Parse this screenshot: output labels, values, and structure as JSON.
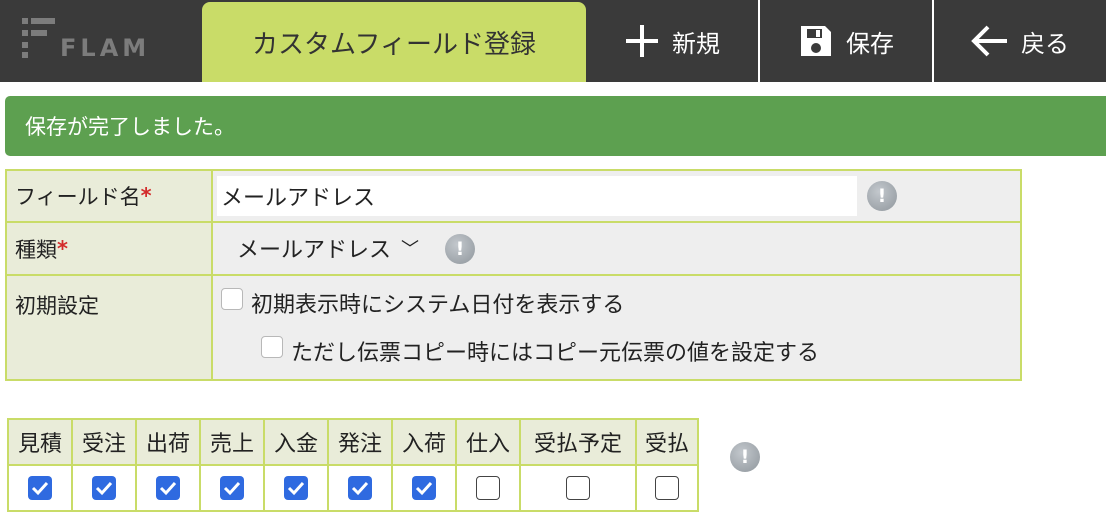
{
  "header": {
    "logo_text": "FLAM",
    "page_title": "カスタムフィールド登録",
    "new_label": "新規",
    "save_label": "保存",
    "back_label": "戻る"
  },
  "alert": {
    "message": "保存が完了しました。"
  },
  "form": {
    "field_name": {
      "label": "フィールド名",
      "required_mark": "*",
      "value": "メールアドレス",
      "info_icon": "!"
    },
    "type": {
      "label": "種類",
      "required_mark": "*",
      "selected": "メールアドレス",
      "chevron": "﹀",
      "info_icon": "!"
    },
    "initial": {
      "label": "初期設定",
      "opt1": {
        "label": "初期表示時にシステム日付を表示する",
        "checked": false
      },
      "opt2": {
        "label": "ただし伝票コピー時にはコピー元伝票の値を設定する",
        "checked": false
      }
    }
  },
  "flags": {
    "info_icon": "!",
    "columns": [
      {
        "label": "見積",
        "checked": true
      },
      {
        "label": "受注",
        "checked": true
      },
      {
        "label": "出荷",
        "checked": true
      },
      {
        "label": "売上",
        "checked": true
      },
      {
        "label": "入金",
        "checked": true
      },
      {
        "label": "発注",
        "checked": true
      },
      {
        "label": "入荷",
        "checked": true
      },
      {
        "label": "仕入",
        "checked": false
      },
      {
        "label": "受払予定",
        "checked": false
      },
      {
        "label": "受払",
        "checked": false
      }
    ]
  },
  "colors": {
    "accent": "#c9dc68",
    "alert_bg": "#5da050",
    "header_bg": "#3a3a3a",
    "check_blue": "#2f6ae0",
    "required": "#d32b2b"
  }
}
